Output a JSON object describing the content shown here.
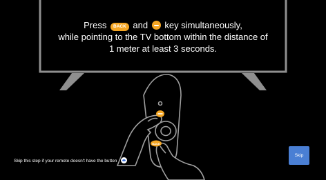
{
  "instruction": {
    "press_word": "Press",
    "back_key_label": "BACK",
    "and_word": "and",
    "key_tail": "key simultaneously,",
    "line2": "while pointing to the TV bottom within the distance of",
    "line3": "1 meter at least 3 seconds."
  },
  "remote": {
    "back_button_label": "BACK"
  },
  "footer": {
    "skip_note": "Skip this step if your remote doesn't have the button",
    "skip_button_label": "Skip"
  },
  "colors": {
    "background": "#000000",
    "accent_key": "#f5a623",
    "skip_button": "#4a7fd4",
    "outline": "#8a8a8a"
  },
  "icons": [
    "minus-key-icon",
    "info-icon"
  ]
}
